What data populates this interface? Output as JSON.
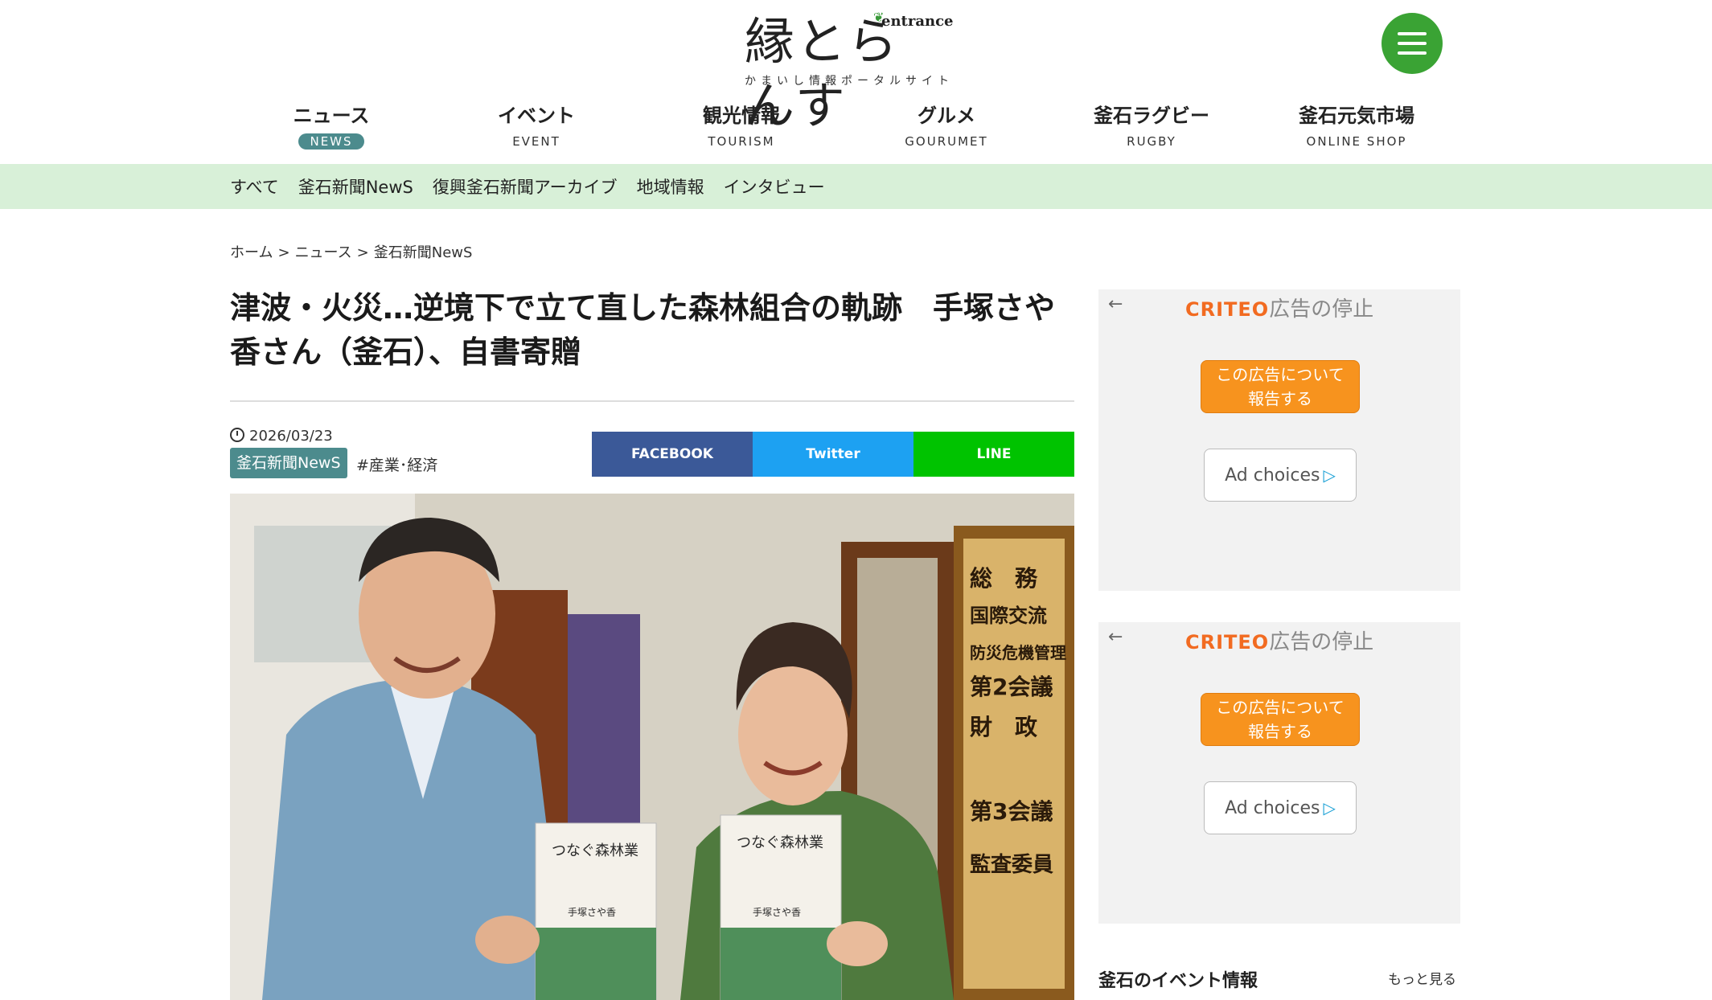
{
  "logo": {
    "main": "縁とらんす",
    "entrance": "entrance",
    "tagline": "かまいし情報ポータルサイト"
  },
  "nav": [
    {
      "jp": "ニュース",
      "en": "NEWS",
      "active": true
    },
    {
      "jp": "イベント",
      "en": "EVENT",
      "active": false
    },
    {
      "jp": "観光情報",
      "en": "TOURISM",
      "active": false
    },
    {
      "jp": "グルメ",
      "en": "GOURUMET",
      "active": false
    },
    {
      "jp": "釜石ラグビー",
      "en": "RUGBY",
      "active": false
    },
    {
      "jp": "釜石元気市場",
      "en": "ONLINE SHOP",
      "active": false
    }
  ],
  "subnav": [
    "すべて",
    "釜石新聞NewS",
    "復興釜石新聞アーカイブ",
    "地域情報",
    "インタビュー"
  ],
  "breadcrumb": [
    "ホーム",
    "ニュース",
    "釜石新聞NewS"
  ],
  "breadcrumb_sep": ">",
  "article": {
    "title": "津波・火災…逆境下で立て直した森林組合の軌跡　手塚さや香さん（釜石）、自書寄贈",
    "date": "2026/03/23",
    "category": "釜石新聞NewS",
    "tag": "#産業･経済"
  },
  "share": {
    "facebook": "FACEBOOK",
    "twitter": "Twitter",
    "line": "LINE"
  },
  "photo": {
    "book_title": "つなぐ森林業",
    "author": "手塚さや香",
    "sign_lines": [
      "総　務",
      "国際交流",
      "防災危機管理",
      "第2会議",
      "財　政",
      "第3会議",
      "監査委員"
    ]
  },
  "ads": [
    {
      "brand": "CRITEO",
      "stop": "広告の停止",
      "report": "この広告について報告する",
      "report_l1": "この広告について",
      "report_l2": "報告する",
      "choices": "Ad choices"
    },
    {
      "brand": "CRITEO",
      "stop": "広告の停止",
      "report": "この広告について報告する",
      "report_l1": "この広告について",
      "report_l2": "報告する",
      "choices": "Ad choices"
    }
  ],
  "events": {
    "title": "釜石のイベント情報",
    "more": "もっと見る"
  },
  "colors": {
    "brand_green": "#3aa334",
    "teal": "#4c8b8d",
    "subnav_bg": "#d8f0d8",
    "facebook": "#3b5998",
    "twitter": "#1da1f2",
    "line": "#00c300",
    "ad_orange": "#f7931e"
  }
}
